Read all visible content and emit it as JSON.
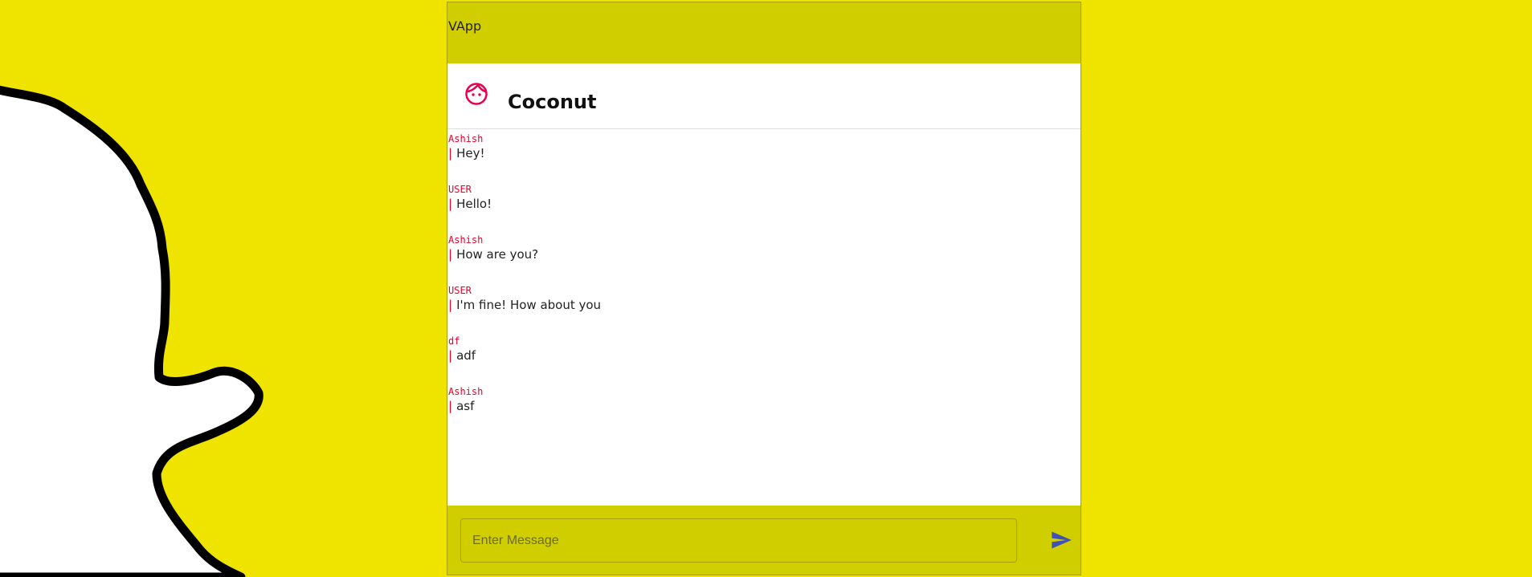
{
  "app": {
    "title": "VApp"
  },
  "chat": {
    "contact_name": "Coconut",
    "contact_icon": "face-icon"
  },
  "messages": [
    {
      "sender": "Ashish",
      "text": "Hey!"
    },
    {
      "sender": "USER",
      "text": "Hello!"
    },
    {
      "sender": "Ashish",
      "text": "How are you?"
    },
    {
      "sender": "USER",
      "text": "I'm fine! How about you"
    },
    {
      "sender": "df",
      "text": "adf"
    },
    {
      "sender": "Ashish",
      "text": "asf"
    }
  ],
  "composer": {
    "placeholder": "Enter Message",
    "value": "",
    "send_icon": "send-icon"
  },
  "colors": {
    "background": "#efe300",
    "header": "#d1ce00",
    "accent": "#e8002a",
    "send": "#3f51b5"
  }
}
